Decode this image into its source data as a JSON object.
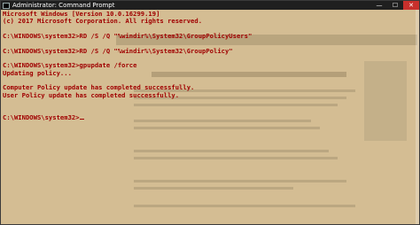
{
  "window": {
    "title": "Administrator: Command Prompt",
    "controls": {
      "minimize": "—",
      "maximize": "☐",
      "close": "✕"
    }
  },
  "console": {
    "lines": [
      "Microsoft Windows [Version 10.0.16299.19]",
      "(c) 2017 Microsoft Corporation. All rights reserved.",
      "",
      "C:\\WINDOWS\\system32>RD /S /Q \"%windir%\\System32\\GroupPolicyUsers\"",
      "",
      "C:\\WINDOWS\\system32>RD /S /Q \"%windir%\\System32\\GroupPolicy\"",
      "",
      "C:\\WINDOWS\\system32>gpupdate /force",
      "Updating policy...",
      "",
      "Computer Policy update has completed successfully.",
      "User Policy update has completed successfully.",
      "",
      "",
      "C:\\WINDOWS\\system32>"
    ],
    "text_color": "#a00000",
    "background_color": "#d4bd93"
  }
}
